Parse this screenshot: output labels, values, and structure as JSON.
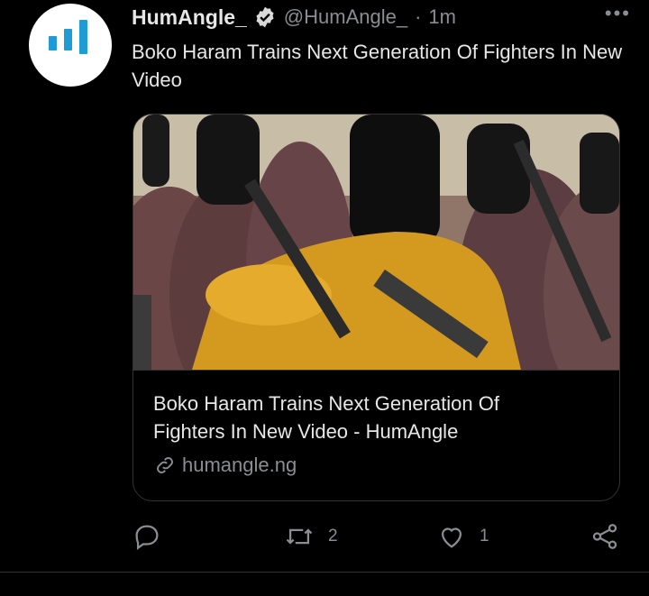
{
  "tweet": {
    "author_name": "HumAngle_",
    "author_handle": "@HumAngle_",
    "separator": "·",
    "time": "1m",
    "more_label": "•••",
    "text": "Boko Haram Trains Next Generation Of Fighters In New Video"
  },
  "card": {
    "title": "Boko Haram Trains Next Generation Of Fighters In New Video - HumAngle",
    "domain": "humangle.ng"
  },
  "actions": {
    "reply_count": "",
    "retweet_count": "2",
    "like_count": "1"
  },
  "colors": {
    "background": "#000000",
    "text": "#e7e7e7",
    "secondary": "#8a8d91",
    "brand": "#1f9bd6"
  }
}
